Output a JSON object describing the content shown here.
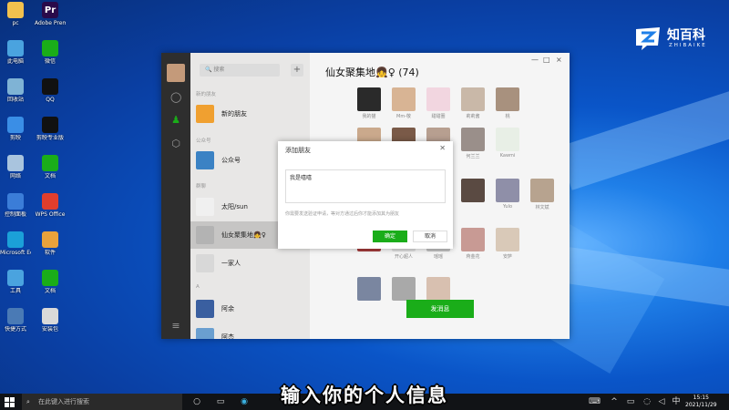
{
  "desktop_icons": [
    {
      "label": "pc",
      "color": "#f2c14e",
      "icon": "folder-icon"
    },
    {
      "label": "Adobe Premiere...",
      "color": "#2a0a4a",
      "icon": "premiere-icon",
      "glyph": "Pr"
    },
    {
      "label": "此电脑",
      "color": "#4aa3df",
      "icon": "computer-icon"
    },
    {
      "label": "微信",
      "color": "#1aad19",
      "icon": "wechat-icon"
    },
    {
      "label": "回收站",
      "color": "#7fb3d5",
      "icon": "document-icon"
    },
    {
      "label": "QQ",
      "color": "#111111",
      "icon": "qq-icon"
    },
    {
      "label": "剪映",
      "color": "#3a8ee6",
      "icon": "capcut-icon"
    },
    {
      "label": "剪映专业版",
      "color": "#111111",
      "icon": "capcut-icon"
    },
    {
      "label": "网络",
      "color": "#a9c4de",
      "icon": "network-icon"
    },
    {
      "label": "文档",
      "color": "#1aad19",
      "icon": "document-icon"
    },
    {
      "label": "控制面板",
      "color": "#3b7dd8",
      "icon": "control-panel-icon"
    },
    {
      "label": "WPS Office",
      "color": "#e03e2d",
      "icon": "wps-icon"
    },
    {
      "label": "Microsoft Edge",
      "color": "#1ba0d8",
      "icon": "edge-icon"
    },
    {
      "label": "软件",
      "color": "#e9a23b",
      "icon": "app-icon"
    },
    {
      "label": "工具",
      "color": "#4aa3df",
      "icon": "tool-icon"
    },
    {
      "label": "文档",
      "color": "#1aad19",
      "icon": "document-icon"
    },
    {
      "label": "快捷方式",
      "color": "#4a7ab5",
      "icon": "shortcut-icon"
    },
    {
      "label": "安装包",
      "color": "#d9d9d9",
      "icon": "installer-icon"
    }
  ],
  "logo": {
    "text": "知百科",
    "sub": "ZHIBAIKE",
    "mark": "Z"
  },
  "wechat": {
    "window_controls": [
      "—",
      "□",
      "×"
    ],
    "search_placeholder": "搜索",
    "plus": "+",
    "sections": {
      "new_friends": "新的朋友",
      "official": "公众号",
      "groups": "群聊",
      "a": "A"
    },
    "contacts": [
      {
        "label": "新的朋友",
        "color": "#f0a030"
      },
      {
        "label": "公众号",
        "color": "#3b82c4"
      },
      {
        "label": "太阳/sun",
        "color": "#f0f0f0"
      },
      {
        "label": "仙女聚集地👧♀",
        "color": "#b3b3b3",
        "selected": true
      },
      {
        "label": "一家人",
        "color": "#d8d8d8"
      },
      {
        "label": "阿余",
        "color": "#3a5fa0"
      },
      {
        "label": "阿杰",
        "color": "#6a9fd0"
      }
    ],
    "group_title": "仙女聚集地👧♀ (74)",
    "members": [
      {
        "name": "我的猫",
        "color": "#2a2a2a"
      },
      {
        "name": "Mm-敬",
        "color": "#d8b494"
      },
      {
        "name": "甜甜圈",
        "color": "#f2d6e0"
      },
      {
        "name": "莉莉酱",
        "color": "#c9b8a8"
      },
      {
        "name": "桃",
        "color": "#a8917e"
      },
      {
        "name": "",
        "color": "#caa98c"
      },
      {
        "name": "",
        "color": "#7a5a48"
      },
      {
        "name": "",
        "color": "#b79f90"
      },
      {
        "name": "何兰兰",
        "color": "#9a8f8a"
      },
      {
        "name": "Kawmi",
        "color": "#e8efe6"
      },
      {
        "name": "",
        "color": "#d1b8a4"
      },
      {
        "name": "",
        "color": "#5a4a42"
      },
      {
        "name": "Yulo",
        "color": "#8f8fa8"
      },
      {
        "name": "林文斌",
        "color": "#b7a38f"
      },
      {
        "name": "",
        "color": "#a33a3a"
      },
      {
        "name": "开心超人",
        "color": "#dcdcdc"
      },
      {
        "name": "瑶瑶",
        "color": "#c0c0c0"
      },
      {
        "name": "蒋金花",
        "color": "#c89a94"
      },
      {
        "name": "安萨",
        "color": "#d9c9b8"
      },
      {
        "name": "",
        "color": "#7a86a0"
      },
      {
        "name": "",
        "color": "#a9a9a9"
      },
      {
        "name": "",
        "color": "#d8c0b0"
      }
    ],
    "send_button": "发消息"
  },
  "dialog": {
    "title": "添加朋友",
    "close": "✕",
    "input_value": "我是嘻嘻",
    "hint": "你需要发送验证申请，等对方通过后你才能添加其为朋友",
    "ok": "确定",
    "cancel": "取消"
  },
  "subtitle": "输入你的个人信息",
  "taskbar": {
    "search_placeholder": "在此键入进行搜索",
    "time": "15:15",
    "date": "2021/11/29"
  }
}
